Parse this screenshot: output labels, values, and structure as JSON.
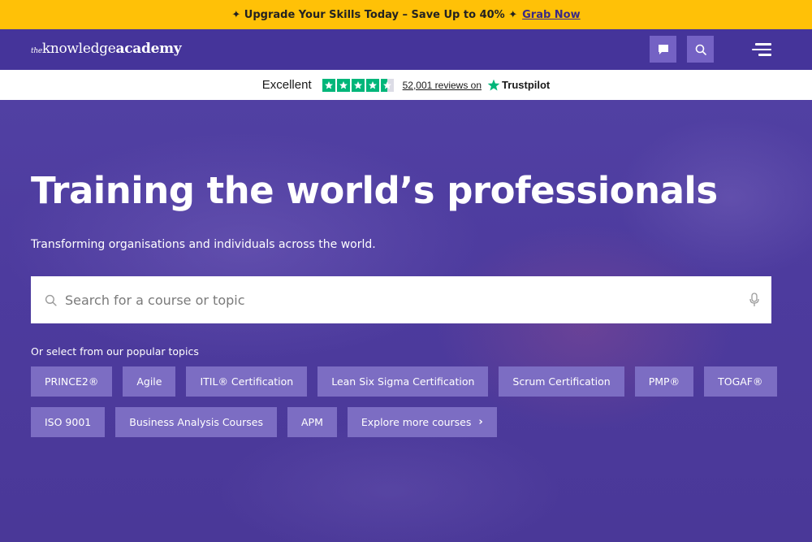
{
  "promo": {
    "text": "✦ Upgrade Your Skills Today – Save Up to 40% ✦",
    "link_label": "Grab Now"
  },
  "nav": {
    "logo_the": "the",
    "logo_knowledge": "knowledge",
    "logo_academy": "academy",
    "chat_icon": "chat-bubble-icon",
    "search_icon": "search-icon",
    "menu_icon": "hamburger-menu-icon"
  },
  "trustpilot": {
    "rating_text": "Excellent",
    "stars": 4.5,
    "reviews_text": "52,001 reviews on",
    "brand": "Trustpilot"
  },
  "hero": {
    "title": "Training the world’s professionals",
    "subtitle": "Transforming organisations and individuals across the world.",
    "search_placeholder": "Search for a course or topic",
    "topics_label": "Or select from our popular topics",
    "topics_row1": [
      "PRINCE2®",
      "Agile",
      "ITIL® Certification",
      "Lean Six Sigma Certification",
      "Scrum Certification",
      "PMP®",
      "TOGAF®"
    ],
    "topics_row2": [
      "ISO 9001",
      "Business Analysis Courses",
      "APM"
    ],
    "explore_label": "Explore more courses"
  },
  "colors": {
    "promo_bg": "#ffc107",
    "nav_bg": "#45349a",
    "hero_bg": "#4a3898",
    "chip_bg": "#7c6dc3",
    "trust_green": "#00b67a"
  }
}
